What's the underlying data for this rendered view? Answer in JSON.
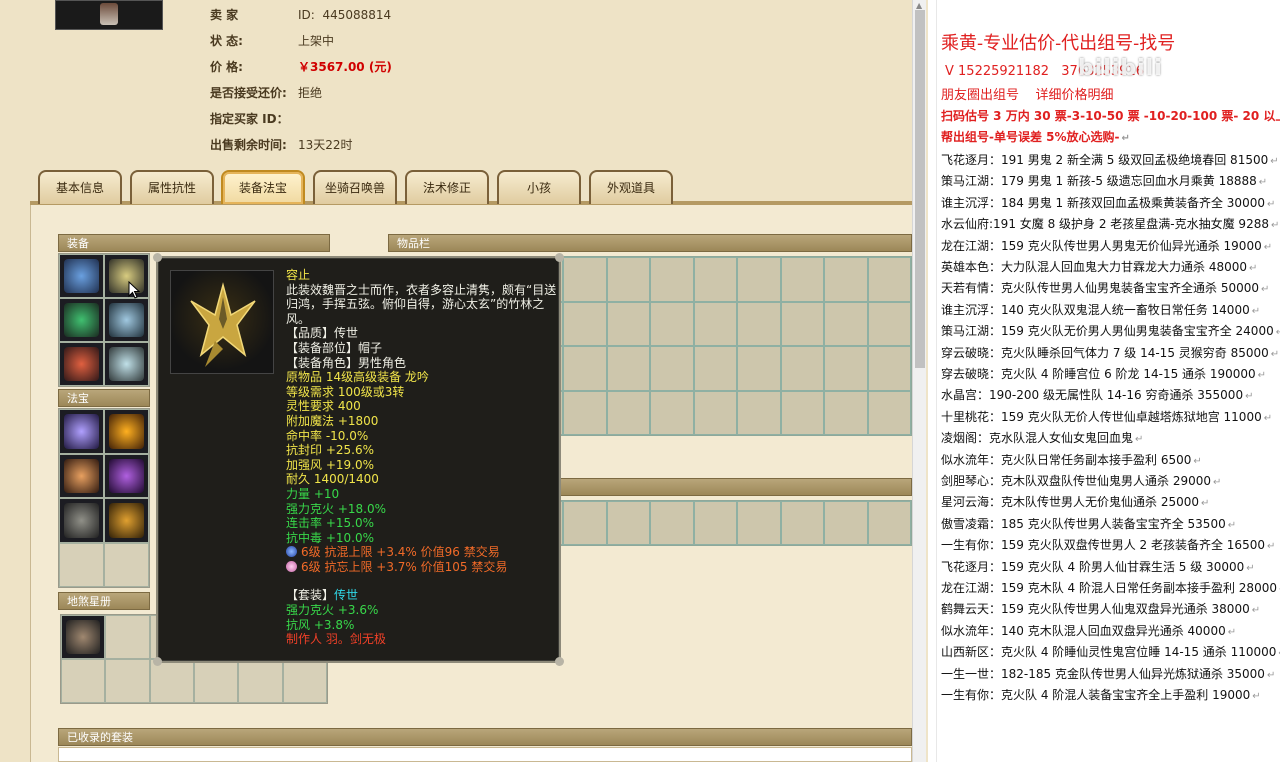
{
  "seller": {
    "seller_id_label": "卖    家",
    "seller_id_prefix": "ID:",
    "seller_id": "445088814",
    "status_label": "状    态:",
    "status": "上架中",
    "price_label": "价    格:",
    "price": "￥3567.00 (元)",
    "counteroffer_label": "是否接受还价:",
    "counteroffer": "拒绝",
    "buyer_label": "指定买家 ID：",
    "buyer": "",
    "remaining_label": "出售剩余时间:",
    "remaining": "13天22时"
  },
  "tabs": [
    "基本信息",
    "属性抗性",
    "装备法宝",
    "坐骑召唤兽",
    "法术修正",
    "小孩",
    "外观道具"
  ],
  "sections": {
    "equipment": "装备",
    "treasure": "法宝",
    "star_book": "地煞星册",
    "inventory": "物品栏",
    "collected_sets": "已收录的套装"
  },
  "tooltip": {
    "name": "容止",
    "desc": "此装效魏晋之士而作，衣者多容止清隽，颇有“目送归鸿，手挥五弦。俯仰自得，游心太玄”的竹林之风。",
    "quality": "【品质】传世",
    "slot": "【装备部位】帽子",
    "role": "【装备角色】男性角色",
    "origin": "原物品 14级高级装备 龙吟",
    "level_req": "等级需求 100级或3转",
    "spirit_req": "灵性要求 400",
    "stats": [
      "附加魔法 +1800",
      "命中率 -10.0%",
      "抗封印 +25.6%",
      "加强风 +19.0%",
      "耐久 1400/1400"
    ],
    "strength": "力量 +10",
    "green_stats": [
      "强力克火 +18.0%",
      "连击率 +15.0%",
      "抗中毒 +10.0%"
    ],
    "gems": [
      "6级 抗混上限 +3.4% 价值96 禁交易",
      "6级 抗忘上限 +3.7% 价值105 禁交易"
    ],
    "set_label": "【套装】",
    "set_name": "传世",
    "set_stats": [
      "强力克火 +3.6%",
      "抗风 +3.8%"
    ],
    "maker": "制作人 羽。剑无极"
  },
  "doc": {
    "title": "乘黄-专业估价-代出组号-找号",
    "phone": "V 15225921182",
    "phone_partial": "3763253916",
    "moments": "朋友圈出组号",
    "moments2": "详细价格明细",
    "pricing": "扫码估号 3 万内 30 票-3-10-50 票 -10-20-100 票- 20 以上 150",
    "service": "帮出组号-单号误差 5%放心选购-",
    "watermark": "bilibili",
    "listings": [
      "飞花逐月：191 男鬼 2 新全满 5 级双回孟极绝境春回 81500",
      "策马江湖：179 男鬼 1 新孩-5 级遗忘回血水月乘黄 18888",
      "谁主沉浮：184 男鬼 1 新孩双回血孟极乘黄装备齐全 30000",
      "水云仙府:191 女魔 8 级护身 2 老孩星盘满-克水抽女魔 9288",
      "龙在江湖：159 克火队传世男人男鬼无价仙异光通杀 19000",
      "英雄本色：大力队混人回血鬼大力甘霖龙大力通杀 48000",
      "天若有情：克火队传世男人仙男鬼装备宝宝齐全通杀 50000",
      "谁主沉浮：140 克火队双鬼混人统一畜牧日常任务 14000",
      "策马江湖：159 克火队无价男人男仙男鬼装备宝宝齐全 24000",
      "穿云破晓：克火队睡杀回气体力 7 级 14-15 灵猴穷奇 85000",
      "穿去破晓：克火队 4 阶睡宫位 6 阶龙 14-15 通杀 190000",
      "水晶宫：190-200 级无属性队 14-16 穷奇通杀 355000",
      "十里桃花：159 克火队无价人传世仙卓越塔炼狱地宫 11000",
      "凌烟阁：克水队混人女仙女鬼回血鬼",
      "似水流年：克火队日常任务副本接手盈利 6500",
      "剑胆琴心：克木队双盘队传世仙鬼男人通杀 29000",
      "星河云海：克木队传世男人无价鬼仙通杀 25000",
      "傲雪凌霜：185 克火队传世男人装备宝宝齐全 53500",
      "一生有你：159 克火队双盘传世男人 2 老孩装备齐全 16500",
      "飞花逐月：159 克火队 4 阶男人仙甘霖生活 5 级 30000",
      "龙在江湖：159 克木队 4 阶混人日常任务副本接手盈利 28000",
      "鹤舞云天：159 克火队传世男人仙鬼双盘异光通杀 38000",
      "似水流年：140 克木队混人回血双盘异光通杀 40000",
      "山西新区：克火队 4 阶睡仙灵性鬼宫位睡 14-15 通杀 110000",
      "一生一世：182-185 克金队传世男人仙异光炼狱通杀 35000",
      "一生有你：克火队 4 阶混人装备宝宝齐全上手盈利 19000"
    ]
  }
}
